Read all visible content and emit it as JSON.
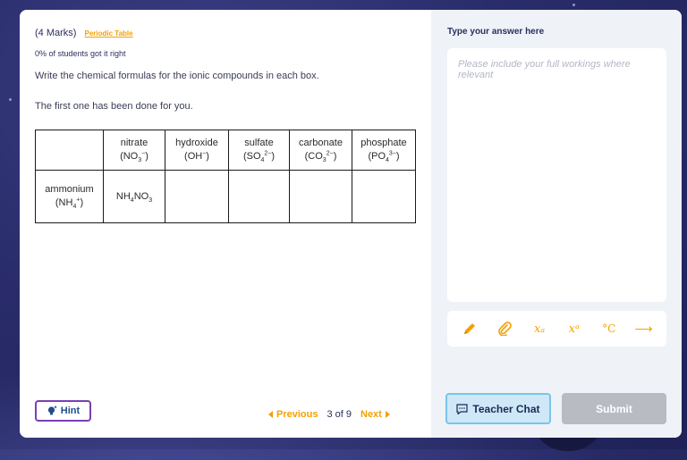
{
  "question": {
    "marks": "(4 Marks)",
    "periodic_table_link": "Periodic Table",
    "stats": "0% of students got it right",
    "instruction": "Write the chemical formulas for the ionic compounds in each box.",
    "first_done": "The first one has been done for you."
  },
  "table": {
    "headers": [
      {
        "name": "nitrate",
        "ion": "(NO",
        "sub": "3",
        "sup": "−",
        "end": ")"
      },
      {
        "name": "hydroxide",
        "ion": "(OH",
        "sub": "",
        "sup": "−",
        "end": ")"
      },
      {
        "name": "sulfate",
        "ion": "(SO",
        "sub": "4",
        "sup": "2−",
        "end": ")"
      },
      {
        "name": "carbonate",
        "ion": "(CO",
        "sub": "3",
        "sup": "2−",
        "end": ")"
      },
      {
        "name": "phosphate",
        "ion": "(PO",
        "sub": "4",
        "sup": "3−",
        "end": ")"
      }
    ],
    "row": {
      "name": "ammonium",
      "ion": "(NH",
      "sub": "4",
      "sup": "+",
      "end": ")",
      "answer": {
        "a": "NH",
        "sub": "4",
        "b": "NO",
        "sub2": "3"
      }
    }
  },
  "footer": {
    "hint": "Hint",
    "previous": "Previous",
    "page_count": "3 of 9",
    "next": "Next"
  },
  "answer_panel": {
    "label": "Type your answer here",
    "placeholder": "Please include your full workings where relevant",
    "tools": [
      "pencil-icon",
      "paperclip-icon",
      "subscript-icon",
      "superscript-icon",
      "degree-celsius-icon",
      "arrow-right-icon"
    ],
    "tool_glyphs": {
      "subscript": "𝑥ₐ",
      "superscript": "𝑥ᵃ",
      "celsius": "°C",
      "arrow": "⟶"
    },
    "teacher_chat": "Teacher Chat",
    "submit": "Submit"
  },
  "colors": {
    "accent": "#f5a000",
    "hint_border": "#7a3fb3",
    "teacher_bg": "#cfe8f7",
    "submit_bg": "#b8bbc2"
  }
}
